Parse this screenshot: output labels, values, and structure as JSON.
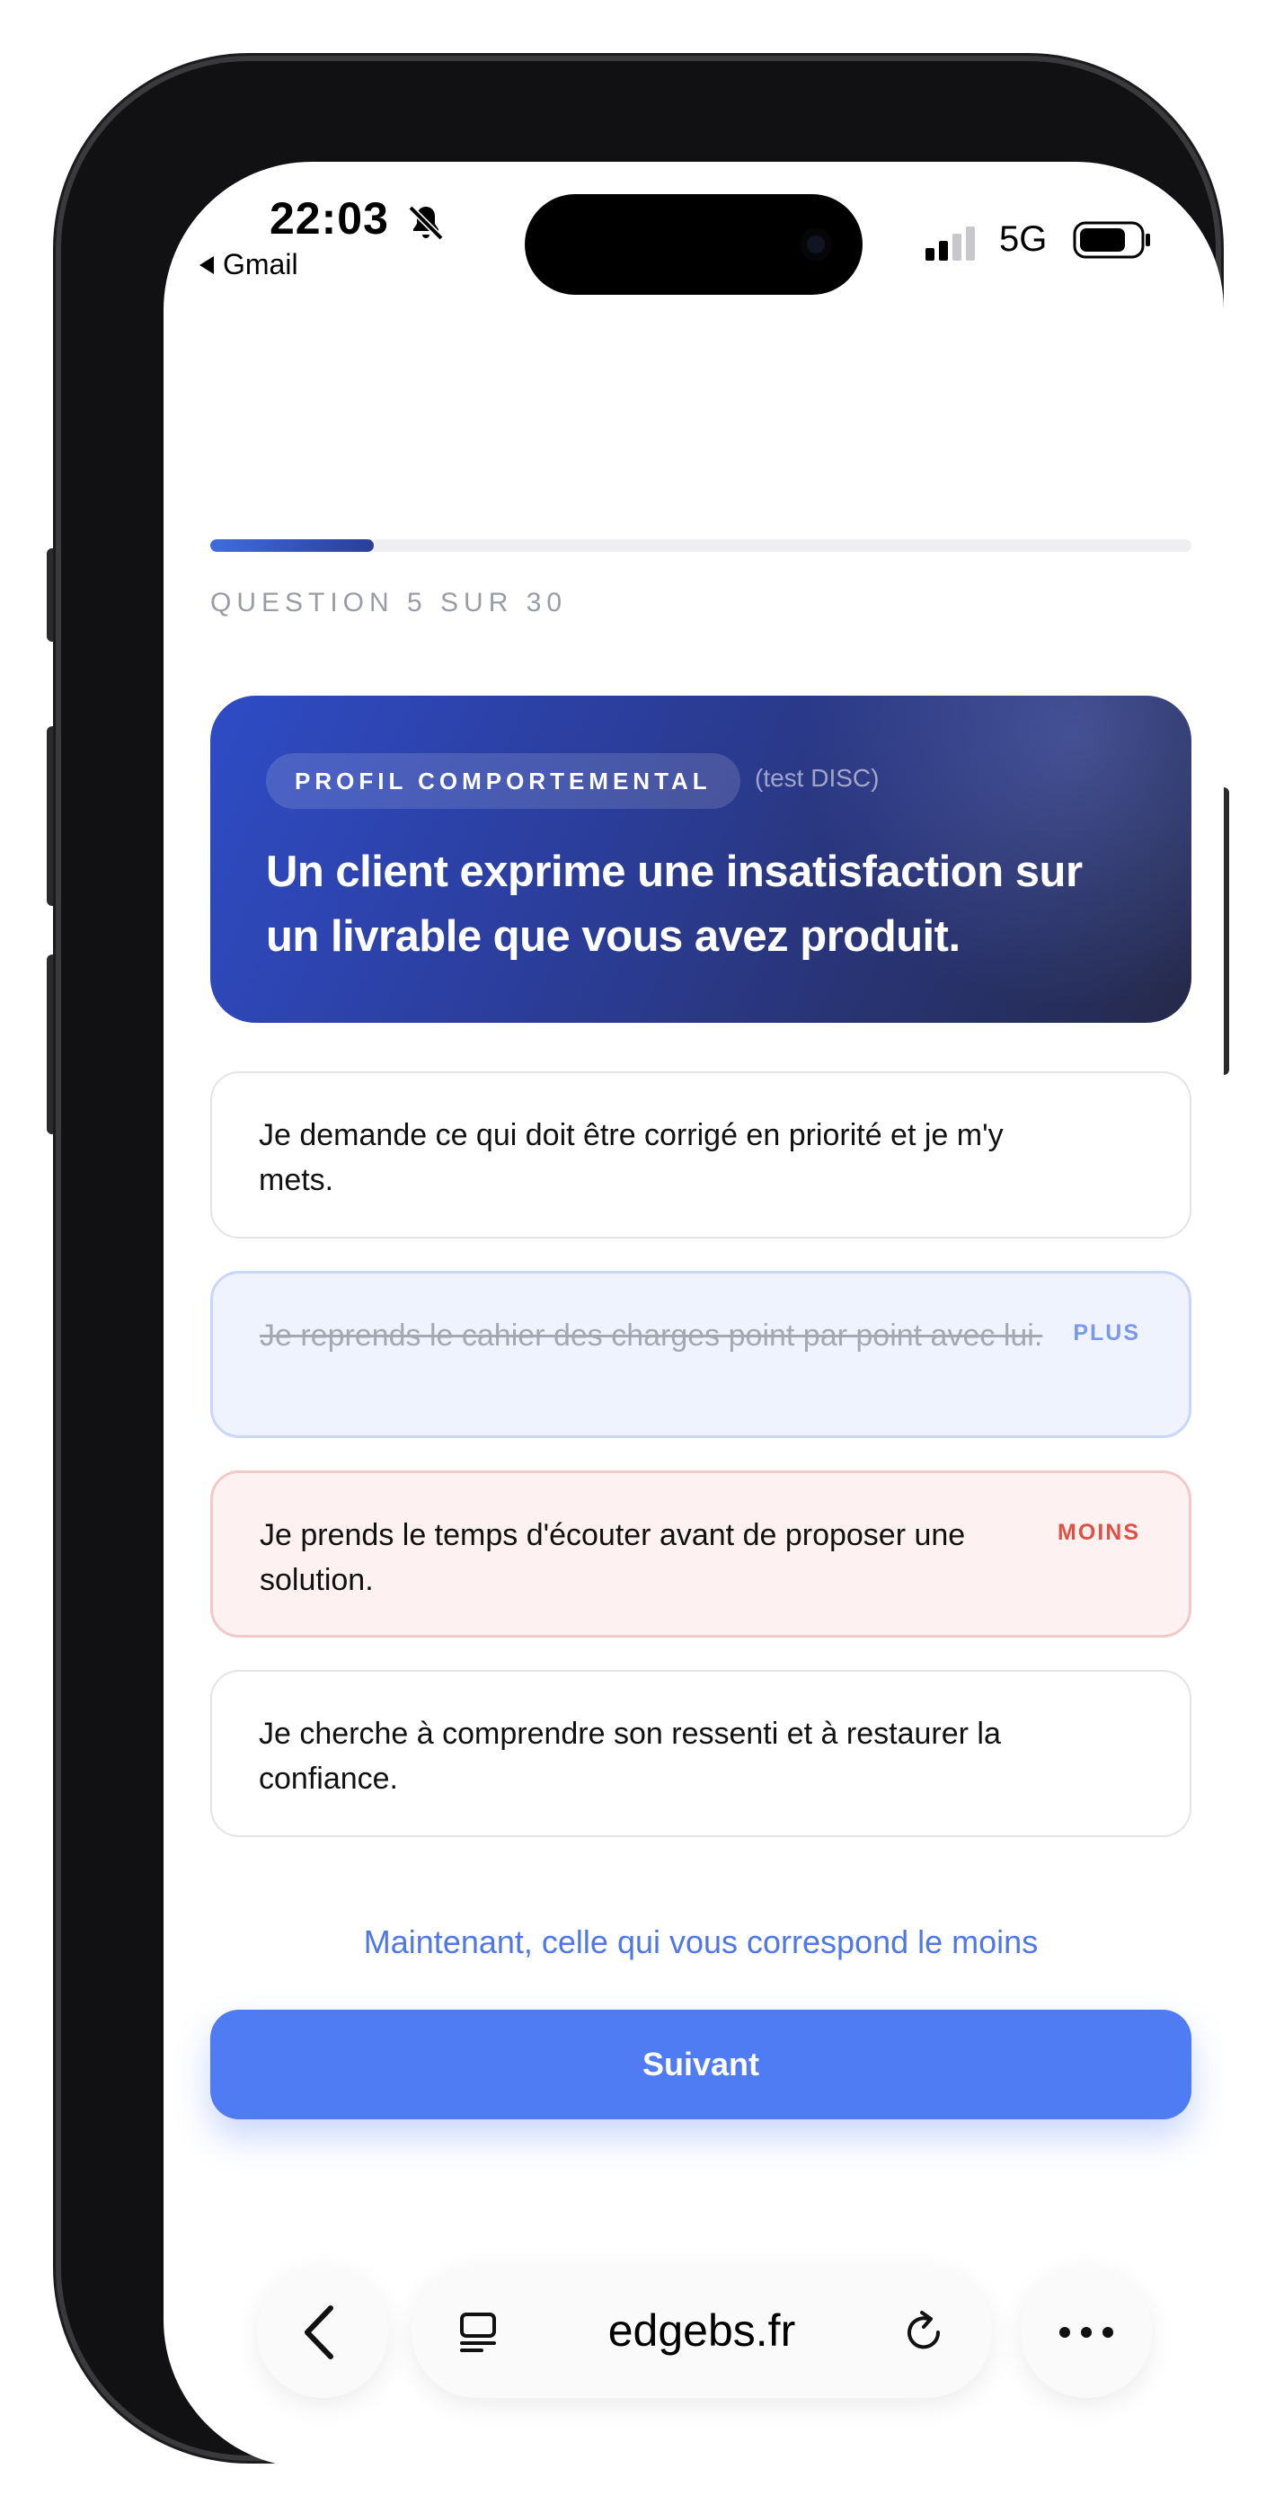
{
  "status_bar": {
    "time": "22:03",
    "back_app": "Gmail",
    "network": "5G",
    "icons": [
      "bell-slash-icon",
      "cellular-signal-icon",
      "battery-icon"
    ]
  },
  "quiz": {
    "progress_fraction": 0.1667,
    "counter": "QUESTION 5 SUR 30",
    "category": "PROFIL COMPORTEMENTAL",
    "category_sub": "(test DISC)",
    "question": "Un client exprime une insatisfaction sur un livrable que vous avez produit.",
    "options": [
      {
        "text": "Je demande ce qui doit être corrigé en priorité et je m'y mets.",
        "badge": "",
        "state": "none"
      },
      {
        "text": "Je reprends le cahier des charges point par point avec lui.",
        "badge": "PLUS",
        "state": "plus"
      },
      {
        "text": "Je prends le temps d'écouter avant de proposer une solution.",
        "badge": "MOINS",
        "state": "moins"
      },
      {
        "text": "Je cherche à comprendre son ressenti et à restaurer la confiance.",
        "badge": "",
        "state": "none"
      }
    ],
    "hint": "Maintenant, celle qui vous correspond le moins",
    "next_label": "Suivant",
    "colors": {
      "accent": "#4f7bf3",
      "plus": "#7a9ae8",
      "moins": "#e05045"
    }
  },
  "browser": {
    "url": "edgebs.fr",
    "icons": [
      "back-chevron-icon",
      "tabs-icon",
      "reload-icon",
      "more-icon"
    ]
  }
}
